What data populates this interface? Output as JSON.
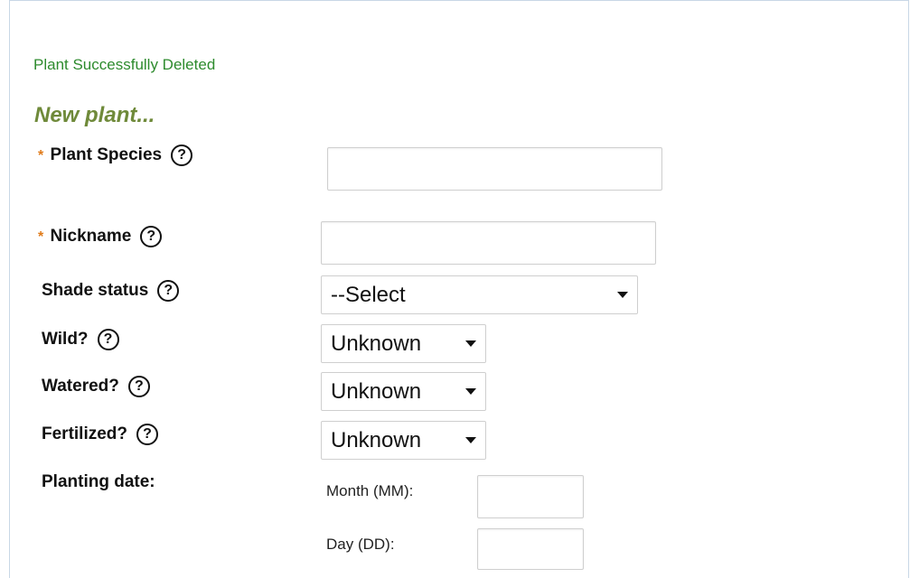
{
  "status_message": "Plant Successfully Deleted",
  "form_title": "New plant...",
  "required_marker": "*",
  "help_glyph": "?",
  "fields": {
    "species": {
      "label": "Plant Species",
      "value": "",
      "required": true
    },
    "nickname": {
      "label": "Nickname",
      "value": "",
      "required": true
    },
    "shade": {
      "label": "Shade status",
      "selected": "--Select"
    },
    "wild": {
      "label": "Wild?",
      "selected": "Unknown"
    },
    "watered": {
      "label": "Watered?",
      "selected": "Unknown"
    },
    "fertilized": {
      "label": "Fertilized?",
      "selected": "Unknown"
    },
    "planting_date": {
      "label": "Planting date:",
      "month_label": "Month (MM):",
      "month_value": "",
      "day_label": "Day (DD):",
      "day_value": ""
    }
  },
  "colors": {
    "status": "#2e8b2e",
    "title": "#6f8a3a",
    "required": "#e07b1a",
    "panel_border": "#c8d7e6"
  }
}
